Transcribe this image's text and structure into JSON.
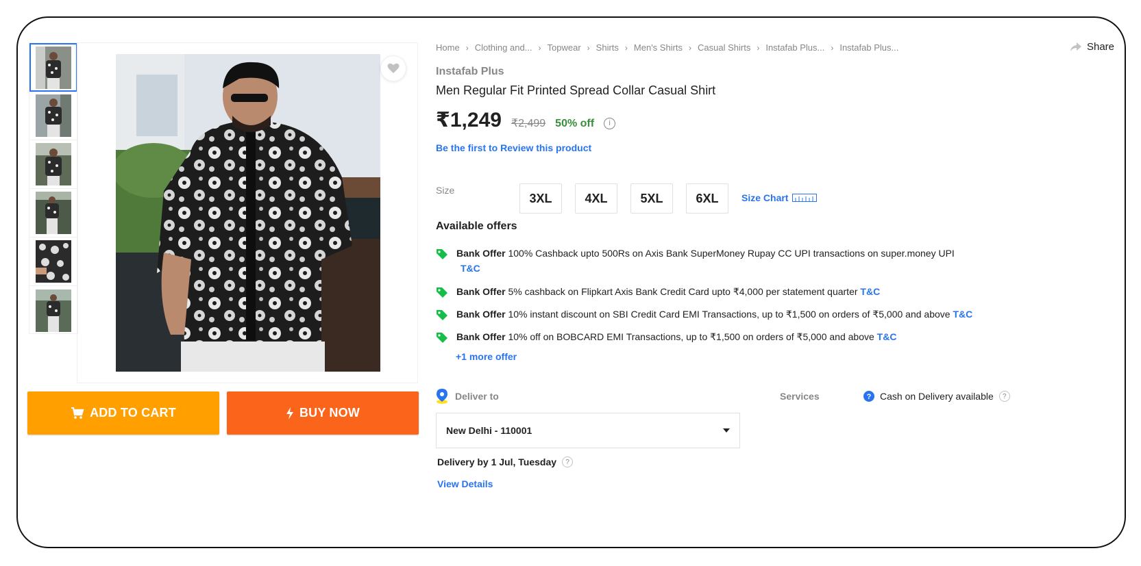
{
  "breadcrumbs": [
    "Home",
    "Clothing and...",
    "Topwear",
    "Shirts",
    "Men's Shirts",
    "Casual Shirts",
    "Instafab Plus...",
    "Instafab Plus..."
  ],
  "share_label": "Share",
  "product": {
    "brand": "Instafab Plus",
    "title": "Men Regular Fit Printed Spread Collar Casual Shirt",
    "price": "₹1,249",
    "mrp": "₹2,499",
    "discount": "50% off",
    "info_icon": "i",
    "review_link": "Be the first to Review this product"
  },
  "size": {
    "label": "Size",
    "options": [
      "3XL",
      "4XL",
      "5XL",
      "6XL"
    ],
    "chart_label": "Size Chart"
  },
  "offers": {
    "title": "Available offers",
    "items": [
      {
        "type": "Bank Offer",
        "text": " 100% Cashback upto 500Rs on Axis Bank SuperMoney Rupay CC UPI transactions on super.money UPI",
        "tc": "T&C"
      },
      {
        "type": "Bank Offer",
        "text": " 5% cashback on Flipkart Axis Bank Credit Card upto ₹4,000 per statement quarter",
        "tc": "T&C"
      },
      {
        "type": "Bank Offer",
        "text": " 10% instant discount on SBI Credit Card EMI Transactions, up to ₹1,500 on orders of ₹5,000 and above",
        "tc": "T&C"
      },
      {
        "type": "Bank Offer",
        "text": " 10% off on BOBCARD EMI Transactions, up to ₹1,500 on orders of ₹5,000 and above",
        "tc": "T&C"
      }
    ],
    "more": "+1 more offer"
  },
  "delivery": {
    "label": "Deliver to",
    "location": "New Delhi - 110001",
    "by": "Delivery by 1 Jul, Tuesday",
    "help_icon": "?",
    "view_details": "View Details"
  },
  "services": {
    "label": "Services",
    "cod": "Cash on Delivery available",
    "help_icon": "?"
  },
  "buttons": {
    "add_to_cart": "ADD TO CART",
    "buy_now": "BUY NOW"
  },
  "colors": {
    "cart": "#ff9f00",
    "buy": "#fb641b",
    "link": "#2874f0",
    "discount": "#388e3c",
    "offer_tag": "#16bd49"
  },
  "icons": {
    "wishlist": "heart-icon",
    "share": "share-arrow-icon",
    "cart": "cart-icon",
    "buy": "lightning-icon",
    "offer": "tag-icon",
    "location": "location-pin-icon",
    "dropdown": "caret-down-icon",
    "cod": "cod-info-icon",
    "size_chart": "ruler-icon"
  }
}
